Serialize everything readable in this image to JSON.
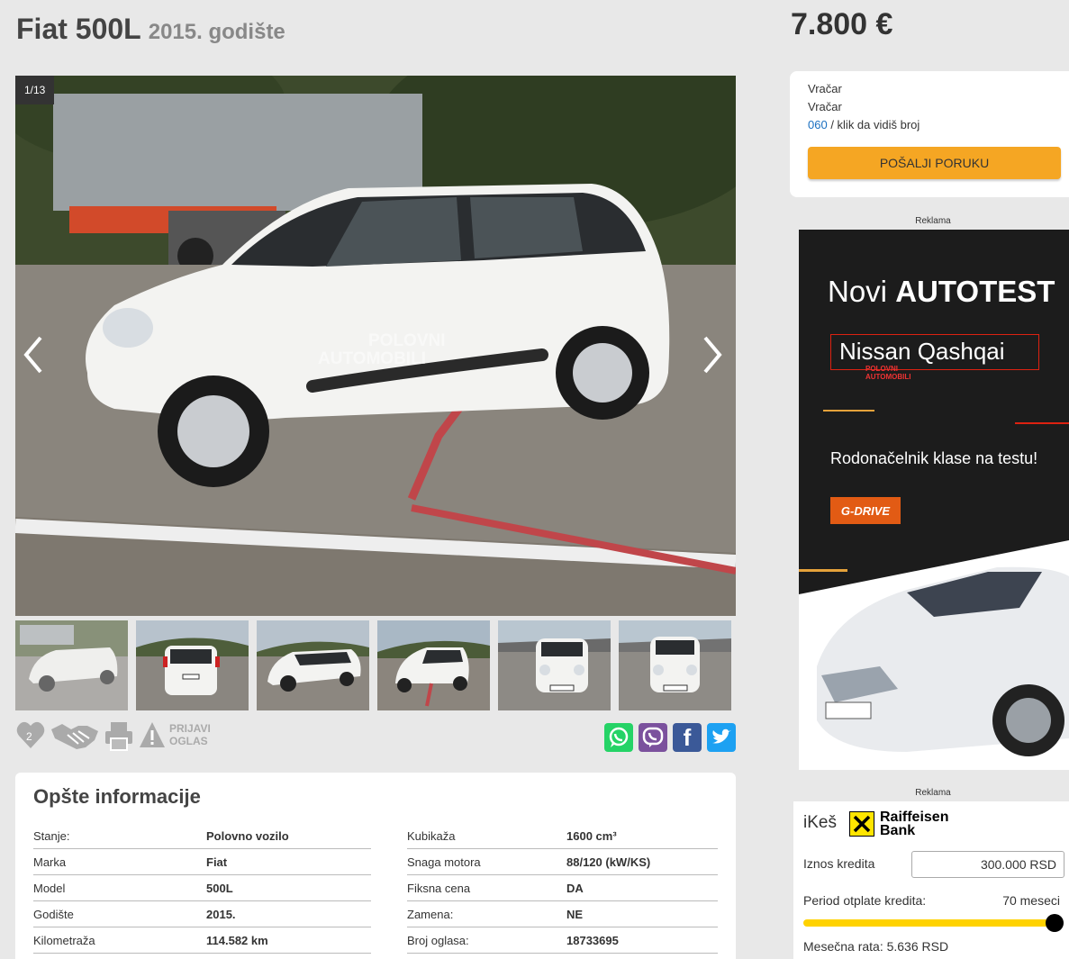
{
  "header": {
    "title": "Fiat 500L",
    "year": "2015. godište",
    "price": "7.800 €"
  },
  "gallery": {
    "counter": "1/13",
    "watermark_line1": "POLOVNI",
    "watermark_line2": "AUTOMOBILI",
    "thumb_count": 6
  },
  "actions": {
    "favorites_count": "2",
    "report_line1": "PRIJAVI",
    "report_line2": "OGLAS"
  },
  "share": [
    "whatsapp-icon",
    "viber-icon",
    "facebook-icon",
    "twitter-icon"
  ],
  "info": {
    "title": "Opšte informacije",
    "left": [
      {
        "k": "Stanje:",
        "v": "Polovno vozilo"
      },
      {
        "k": "Marka",
        "v": "Fiat"
      },
      {
        "k": "Model",
        "v": "500L"
      },
      {
        "k": "Godište",
        "v": "2015."
      },
      {
        "k": "Kilometraža",
        "v": "114.582 km"
      }
    ],
    "right": [
      {
        "k": "Kubikaža",
        "v": "1600 cm³"
      },
      {
        "k": "Snaga motora",
        "v": "88/120 (kW/KS)"
      },
      {
        "k": "Fiksna cena",
        "v": "DA"
      },
      {
        "k": "Zamena:",
        "v": "NE"
      },
      {
        "k": "Broj oglasa:",
        "v": "18733695"
      }
    ]
  },
  "seller": {
    "location1": "Vračar",
    "location2": "Vračar",
    "phone": "060",
    "phone_hint": " / klik da vidiš broj",
    "button": "POŠALJI PORUKU"
  },
  "ad1": {
    "label": "Reklama",
    "title_light": "Novi ",
    "title_bold": "AUTOTEST",
    "model": "Nissan Qashqai",
    "tagline": "Rodonačelnik klase na testu!",
    "gdrive": "G-DRIVE",
    "logo_line1": "POLOVNI",
    "logo_line2": "AUTOMOBILI"
  },
  "loan": {
    "label": "Reklama",
    "brand": "iKeš",
    "bank_line1": "Raiffeisen",
    "bank_line2": "Bank",
    "amount_label": "Iznos kredita",
    "amount_value": "300.000  RSD",
    "period_label": "Period otplate kredita:",
    "period_value": "70 meseci",
    "monthly": "Mesečna rata: 5.636 RSD"
  },
  "colors": {
    "accent": "#f5a623",
    "link": "#1a6fc0",
    "ad_red": "#dd2211",
    "slider": "#ffd200"
  }
}
